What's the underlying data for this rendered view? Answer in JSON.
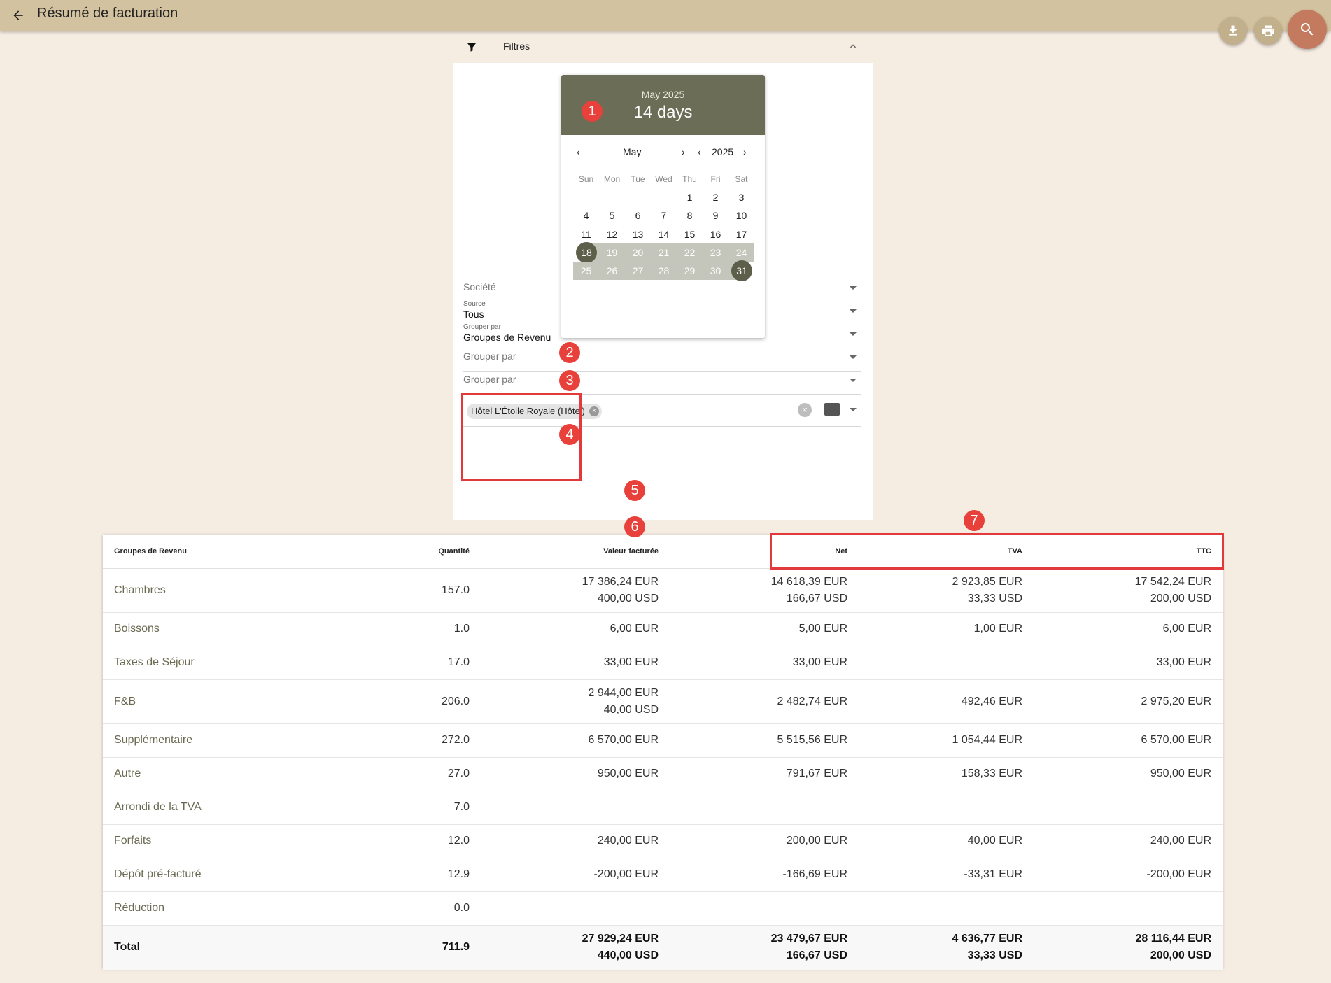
{
  "header": {
    "title": "Résumé de facturation"
  },
  "filters": {
    "label": "Filtres"
  },
  "picker": {
    "month_year": "May 2025",
    "range": "14 days",
    "nav_month": "May",
    "nav_year": "2025",
    "weekdays": [
      "Sun",
      "Mon",
      "Tue",
      "Wed",
      "Thu",
      "Fri",
      "Sat"
    ],
    "weeks": [
      [
        "",
        "",
        "",
        "",
        "1",
        "2",
        "3"
      ],
      [
        "4",
        "5",
        "6",
        "7",
        "8",
        "9",
        "10"
      ],
      [
        "11",
        "12",
        "13",
        "14",
        "15",
        "16",
        "17"
      ],
      [
        "18",
        "19",
        "20",
        "21",
        "22",
        "23",
        "24"
      ],
      [
        "25",
        "26",
        "27",
        "28",
        "29",
        "30",
        "31"
      ]
    ],
    "range_start": "18",
    "range_end": "31"
  },
  "fields": {
    "societe": {
      "placeholder": "Société"
    },
    "source": {
      "label": "Source",
      "value": "Tous"
    },
    "group1": {
      "label": "Grouper par",
      "value": "Groupes de Revenu"
    },
    "group2": {
      "placeholder": "Grouper par"
    },
    "group3": {
      "placeholder": "Grouper par"
    },
    "property_chip": "Hôtel L'Étoile Royale (Hôtel)"
  },
  "badges": [
    "1",
    "2",
    "3",
    "4",
    "5",
    "6",
    "7"
  ],
  "table": {
    "headers": [
      "Groupes de Revenu",
      "Quantité",
      "Valeur facturée",
      "Net",
      "TVA",
      "TTC"
    ],
    "rows": [
      {
        "name": "Chambres",
        "qty": "157.0",
        "valeur": [
          "17 386,24 EUR",
          "400,00 USD"
        ],
        "net": [
          "14 618,39 EUR",
          "166,67 USD"
        ],
        "tva": [
          "2 923,85 EUR",
          "33,33 USD"
        ],
        "ttc": [
          "17 542,24 EUR",
          "200,00 USD"
        ]
      },
      {
        "name": "Boissons",
        "qty": "1.0",
        "valeur": [
          "6,00 EUR"
        ],
        "net": [
          "5,00 EUR"
        ],
        "tva": [
          "1,00 EUR"
        ],
        "ttc": [
          "6,00 EUR"
        ]
      },
      {
        "name": "Taxes de Séjour",
        "qty": "17.0",
        "valeur": [
          "33,00 EUR"
        ],
        "net": [
          "33,00 EUR"
        ],
        "tva": [],
        "ttc": [
          "33,00 EUR"
        ]
      },
      {
        "name": "F&B",
        "qty": "206.0",
        "valeur": [
          "2 944,00 EUR",
          "40,00 USD"
        ],
        "net": [
          "2 482,74 EUR"
        ],
        "tva": [
          "492,46 EUR"
        ],
        "ttc": [
          "2 975,20 EUR"
        ]
      },
      {
        "name": "Supplémentaire",
        "qty": "272.0",
        "valeur": [
          "6 570,00 EUR"
        ],
        "net": [
          "5 515,56 EUR"
        ],
        "tva": [
          "1 054,44 EUR"
        ],
        "ttc": [
          "6 570,00 EUR"
        ]
      },
      {
        "name": "Autre",
        "qty": "27.0",
        "valeur": [
          "950,00 EUR"
        ],
        "net": [
          "791,67 EUR"
        ],
        "tva": [
          "158,33 EUR"
        ],
        "ttc": [
          "950,00 EUR"
        ]
      },
      {
        "name": "Arrondi de la TVA",
        "qty": "7.0",
        "valeur": [],
        "net": [],
        "tva": [],
        "ttc": []
      },
      {
        "name": "Forfaits",
        "qty": "12.0",
        "valeur": [
          "240,00 EUR"
        ],
        "net": [
          "200,00 EUR"
        ],
        "tva": [
          "40,00 EUR"
        ],
        "ttc": [
          "240,00 EUR"
        ]
      },
      {
        "name": "Dépôt pré-facturé",
        "qty": "12.9",
        "valeur": [
          "-200,00 EUR"
        ],
        "net": [
          "-166,69 EUR"
        ],
        "tva": [
          "-33,31 EUR"
        ],
        "ttc": [
          "-200,00 EUR"
        ]
      },
      {
        "name": "Réduction",
        "qty": "0.0",
        "valeur": [],
        "net": [],
        "tva": [],
        "ttc": []
      }
    ],
    "total": {
      "name": "Total",
      "qty": "711.9",
      "valeur": [
        "27 929,24 EUR",
        "440,00 USD"
      ],
      "net": [
        "23 479,67 EUR",
        "166,67 USD"
      ],
      "tva": [
        "4 636,77 EUR",
        "33,33 USD"
      ],
      "ttc": [
        "28 116,44 EUR",
        "200,00 USD"
      ]
    }
  },
  "colors": {
    "header_bg": "#d3c29f",
    "page_bg": "#f5ece2",
    "picker_head": "#6b6d56",
    "range": "#c5c6bb",
    "badge": "#e8403a",
    "fab_search": "#c47a5e"
  },
  "icons": {
    "back": "arrow-back-icon",
    "download": "download-icon",
    "print": "print-icon",
    "search": "search-icon",
    "filter": "filter-icon"
  }
}
